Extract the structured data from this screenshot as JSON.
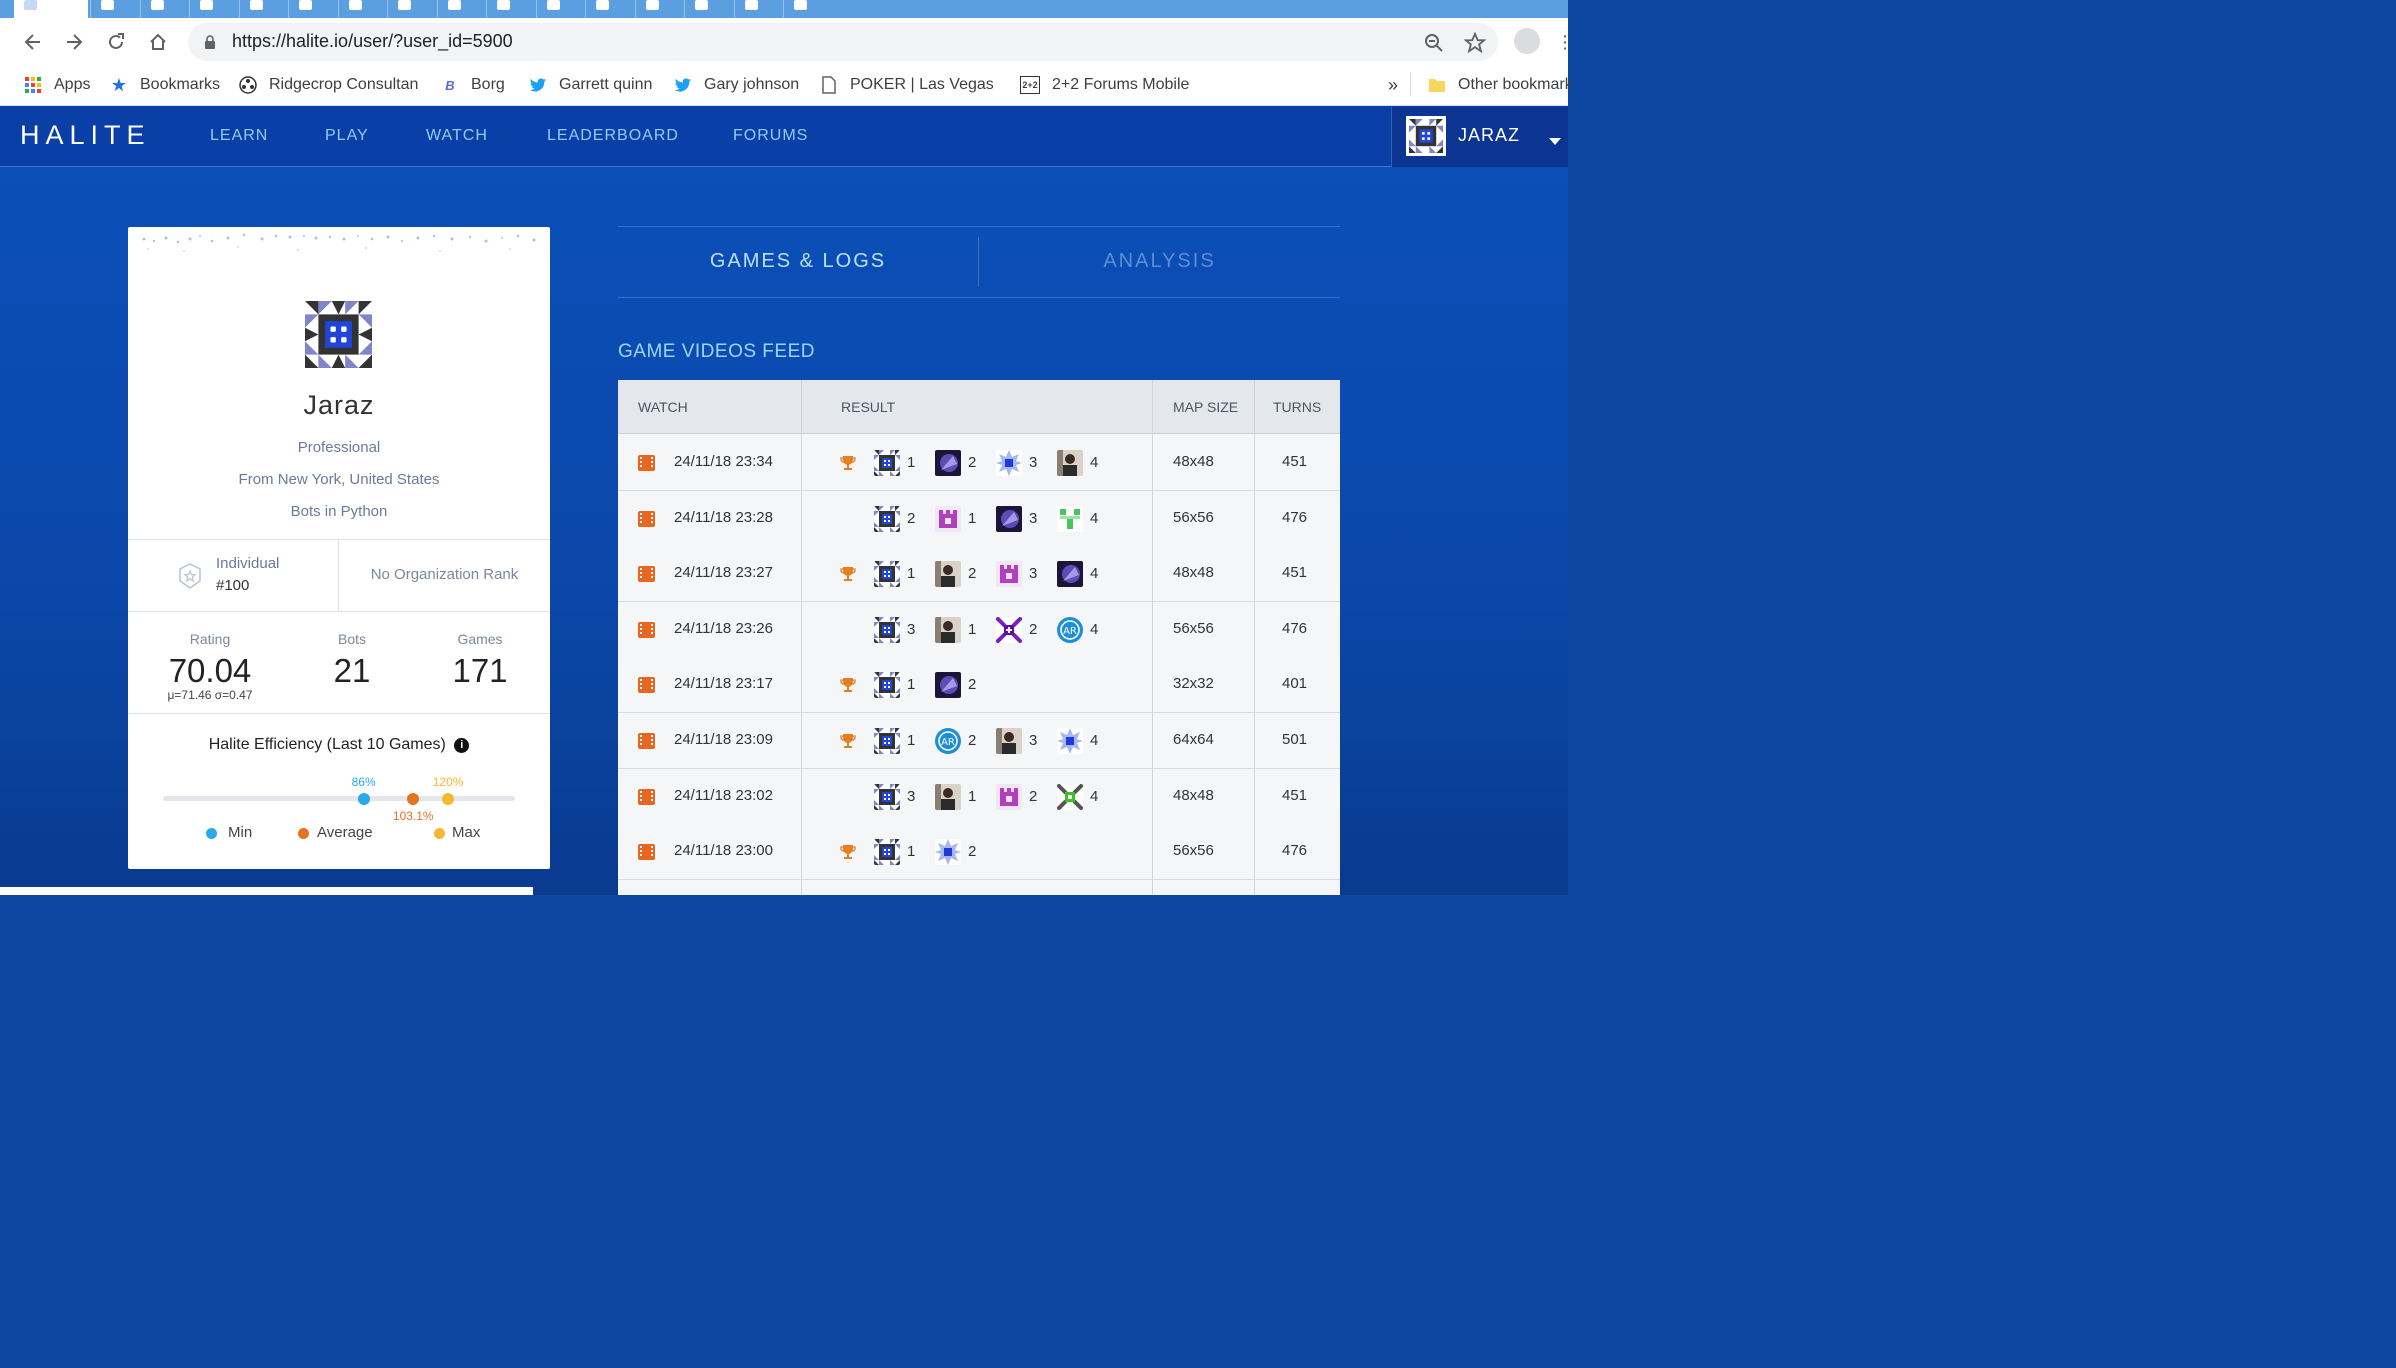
{
  "browser": {
    "url": "https://halite.io/user/?user_id=5900",
    "bookmarks": [
      {
        "label": "Apps",
        "icon": "apps-grid-icon"
      },
      {
        "label": "Bookmarks",
        "icon": "star-icon"
      },
      {
        "label": "Ridgecrop Consultan",
        "icon": "ridgecrop-icon"
      },
      {
        "label": "Borg",
        "icon": "borg-icon"
      },
      {
        "label": "Garrett quinn",
        "icon": "twitter-icon"
      },
      {
        "label": "Gary johnson",
        "icon": "twitter-icon"
      },
      {
        "label": "POKER | Las Vegas Ho",
        "icon": "page-icon"
      },
      {
        "label": "2+2 Forums Mobile",
        "icon": "twoplustwo-icon"
      }
    ],
    "overflow_label": "»",
    "other_bookmarks": "Other bookmark",
    "twoplustwo_badge": "2+2"
  },
  "site": {
    "logo": "HALITE",
    "nav": [
      "LEARN",
      "PLAY",
      "WATCH",
      "LEADERBOARD",
      "FORUMS"
    ],
    "user_menu_label": "JARAZ"
  },
  "profile": {
    "name": "Jaraz",
    "level": "Professional",
    "location": "From New York, United States",
    "language": "Bots in Python",
    "individual_label": "Individual",
    "individual_rank": "#100",
    "org_rank": "No Organization Rank",
    "stats": {
      "rating_label": "Rating",
      "rating": "70.04",
      "rating_detail": "μ=71.46 σ=0.47",
      "bots_label": "Bots",
      "bots": "21",
      "games_label": "Games",
      "games": "171"
    },
    "efficiency": {
      "title": "Halite Efficiency (Last 10 Games)",
      "min_label": "86%",
      "avg_label": "103.1%",
      "max_label": "120%",
      "min_pct": 0.57,
      "avg_pct": 0.71,
      "max_pct": 0.81,
      "legend": [
        "Min",
        "Average",
        "Max"
      ],
      "colors": {
        "min": "#29a9e8",
        "avg": "#e67322",
        "max": "#f5b82e"
      }
    }
  },
  "panel": {
    "tabs": [
      "GAMES & LOGS",
      "ANALYSIS"
    ],
    "feed_title": "GAME VIDEOS FEED",
    "columns": [
      "WATCH",
      "RESULT",
      "MAP SIZE",
      "TURNS"
    ]
  },
  "games": [
    {
      "date": "24/11/18 23:34",
      "win": true,
      "players": [
        [
          "jaraz",
          "1"
        ],
        [
          "purple",
          "2"
        ],
        [
          "blue-star",
          "3"
        ],
        [
          "man",
          "4"
        ]
      ],
      "map": "48x48",
      "turns": "451"
    },
    {
      "date": "24/11/18 23:28",
      "win": false,
      "players": [
        [
          "jaraz",
          "2"
        ],
        [
          "castle",
          "1"
        ],
        [
          "purple",
          "3"
        ],
        [
          "green",
          "4"
        ]
      ],
      "map": "56x56",
      "turns": "476"
    },
    {
      "date": "24/11/18 23:27",
      "win": true,
      "players": [
        [
          "jaraz",
          "1"
        ],
        [
          "man",
          "2"
        ],
        [
          "castle",
          "3"
        ],
        [
          "purple",
          "4"
        ]
      ],
      "map": "48x48",
      "turns": "451"
    },
    {
      "date": "24/11/18 23:26",
      "win": false,
      "players": [
        [
          "jaraz",
          "3"
        ],
        [
          "man",
          "1"
        ],
        [
          "violet-star",
          "2"
        ],
        [
          "ar",
          "4"
        ]
      ],
      "map": "56x56",
      "turns": "476"
    },
    {
      "date": "24/11/18 23:17",
      "win": true,
      "players": [
        [
          "jaraz",
          "1"
        ],
        [
          "purple",
          "2"
        ]
      ],
      "map": "32x32",
      "turns": "401"
    },
    {
      "date": "24/11/18 23:09",
      "win": true,
      "players": [
        [
          "jaraz",
          "1"
        ],
        [
          "ar",
          "2"
        ],
        [
          "man",
          "3"
        ],
        [
          "blue-star",
          "4"
        ]
      ],
      "map": "64x64",
      "turns": "501"
    },
    {
      "date": "24/11/18 23:02",
      "win": false,
      "players": [
        [
          "jaraz",
          "3"
        ],
        [
          "man",
          "1"
        ],
        [
          "castle",
          "2"
        ],
        [
          "green-star",
          "4"
        ]
      ],
      "map": "48x48",
      "turns": "451"
    },
    {
      "date": "24/11/18 23:00",
      "win": true,
      "players": [
        [
          "jaraz",
          "1"
        ],
        [
          "blue-star",
          "2"
        ]
      ],
      "map": "56x56",
      "turns": "476"
    }
  ]
}
